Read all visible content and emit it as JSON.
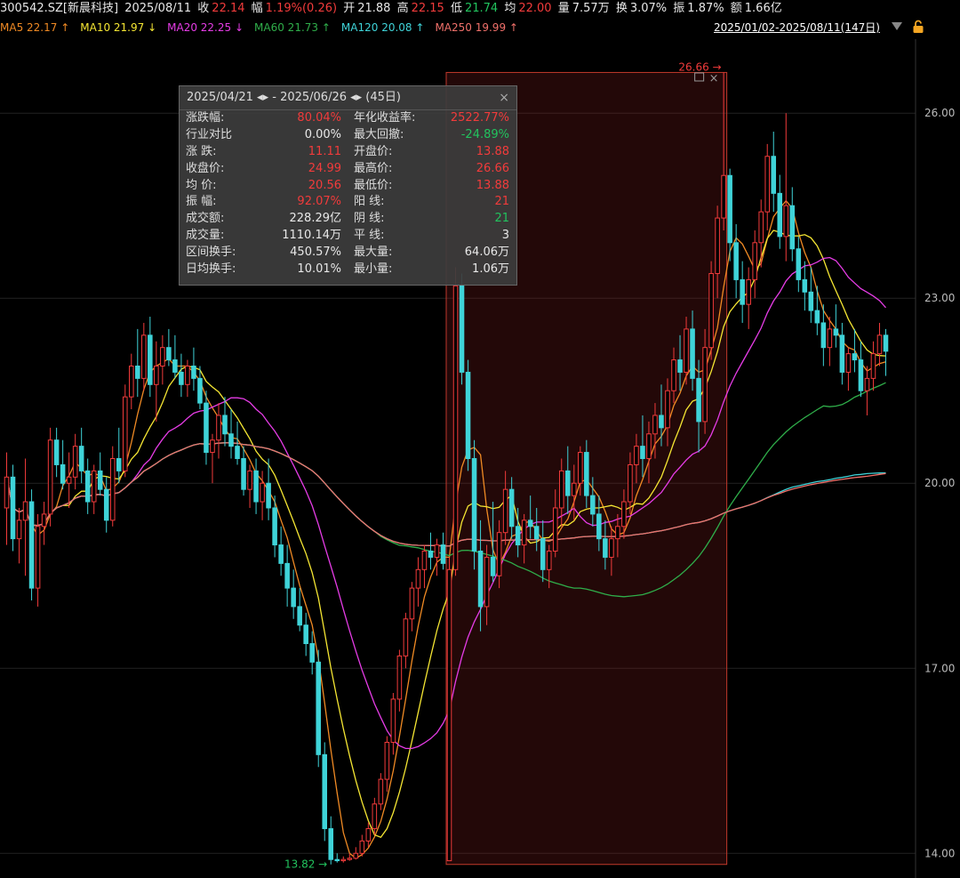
{
  "header": {
    "code": "300542.SZ[新晨科技]",
    "date": "2025/08/11",
    "close_label": "收",
    "close": "22.14",
    "change_label": "幅",
    "change": "1.19%(0.26)",
    "open_label": "开",
    "open": "21.88",
    "high_label": "高",
    "high": "22.15",
    "low_label": "低",
    "low": "21.74",
    "avg_label": "均",
    "avg": "22.00",
    "vol_label": "量",
    "vol": "7.57万",
    "turnover_label": "换",
    "turnover": "3.07%",
    "amp_label": "振",
    "amp": "1.87%",
    "amount_label": "额",
    "amount": "1.66亿"
  },
  "ma_legend": [
    {
      "label": "MA5 22.17",
      "arrow": "↑",
      "color": "#f08a24"
    },
    {
      "label": "MA10 21.97",
      "arrow": "↓",
      "color": "#f5e633"
    },
    {
      "label": "MA20 22.25",
      "arrow": "↓",
      "color": "#e63ce6"
    },
    {
      "label": "MA60 21.73",
      "arrow": "↑",
      "color": "#2fae4a"
    },
    {
      "label": "MA120 20.08",
      "arrow": "↑",
      "color": "#3fd3d8"
    },
    {
      "label": "MA250 19.99",
      "arrow": "↑",
      "color": "#f0706a"
    }
  ],
  "range_label": "2025/01/02-2025/08/11(147日)",
  "stats_panel": {
    "title": "2025/04/21 ◂▸ - 2025/06/26 ◂▸ (45日)",
    "close_icon": "×",
    "rows": [
      [
        {
          "k": "涨跌幅:",
          "v": "80.04%",
          "c": "red"
        },
        {
          "k": "年化收益率:",
          "v": "2522.77%",
          "c": "red"
        }
      ],
      [
        {
          "k": "行业对比",
          "v": "0.00%",
          "c": "white"
        },
        {
          "k": "最大回撤:",
          "v": "-24.89%",
          "c": "green"
        }
      ],
      [
        {
          "k": "涨 跌:",
          "v": "11.11",
          "c": "red"
        },
        {
          "k": "开盘价:",
          "v": "13.88",
          "c": "red"
        }
      ],
      [
        {
          "k": "收盘价:",
          "v": "24.99",
          "c": "red"
        },
        {
          "k": "最高价:",
          "v": "26.66",
          "c": "red"
        }
      ],
      [
        {
          "k": "均 价:",
          "v": "20.56",
          "c": "red"
        },
        {
          "k": "最低价:",
          "v": "13.88",
          "c": "red"
        }
      ],
      [
        {
          "k": "振 幅:",
          "v": "92.07%",
          "c": "red"
        },
        {
          "k": "阳 线:",
          "v": "21",
          "c": "red"
        }
      ],
      [
        {
          "k": "成交额:",
          "v": "228.29亿",
          "c": "white"
        },
        {
          "k": "阴 线:",
          "v": "21",
          "c": "green"
        }
      ],
      [
        {
          "k": "成交量:",
          "v": "1110.14万",
          "c": "white"
        },
        {
          "k": "平 线:",
          "v": "3",
          "c": "white"
        }
      ],
      [
        {
          "k": "区间换手:",
          "v": "450.57%",
          "c": "white"
        },
        {
          "k": "最大量:",
          "v": "64.06万",
          "c": "white"
        }
      ],
      [
        {
          "k": "日均换手:",
          "v": "10.01%",
          "c": "white"
        },
        {
          "k": "最小量:",
          "v": "1.06万",
          "c": "white"
        }
      ]
    ]
  },
  "chart_data": {
    "type": "candlestick",
    "y_ticks": [
      "26.00",
      "23.00",
      "20.00",
      "17.00",
      "14.00"
    ],
    "y_tick_values": [
      26,
      23,
      20,
      17,
      14
    ],
    "ylim": [
      13.6,
      27.2
    ],
    "selection_high_label": "26.66",
    "selection_low_label": "13.82",
    "selection_high": 26.66,
    "selection_low": 13.82,
    "selection_start_index": 71,
    "selection_end_index": 115,
    "up_color": "#f23b3b",
    "down_color": "#3fd3d8",
    "candles": [
      [
        19.6,
        20.5,
        19.0,
        20.1
      ],
      [
        20.1,
        20.3,
        18.9,
        19.1
      ],
      [
        19.1,
        19.6,
        18.7,
        19.4
      ],
      [
        19.4,
        20.4,
        18.5,
        19.7
      ],
      [
        19.7,
        19.9,
        18.1,
        18.3
      ],
      [
        18.3,
        19.5,
        18.0,
        19.3
      ],
      [
        19.3,
        19.7,
        19.0,
        19.5
      ],
      [
        19.5,
        20.9,
        19.3,
        20.7
      ],
      [
        20.7,
        20.9,
        20.1,
        20.3
      ],
      [
        20.3,
        20.7,
        19.9,
        20.0
      ],
      [
        20.0,
        20.5,
        19.6,
        20.1
      ],
      [
        20.1,
        20.8,
        19.9,
        20.6
      ],
      [
        20.6,
        20.9,
        20.0,
        20.2
      ],
      [
        20.2,
        20.4,
        19.5,
        19.7
      ],
      [
        19.7,
        20.3,
        19.5,
        20.2
      ],
      [
        20.2,
        20.5,
        19.8,
        19.9
      ],
      [
        19.9,
        20.1,
        19.2,
        19.4
      ],
      [
        19.4,
        20.6,
        19.3,
        20.4
      ],
      [
        20.4,
        20.9,
        20.0,
        20.2
      ],
      [
        20.2,
        21.6,
        20.1,
        21.4
      ],
      [
        21.4,
        22.1,
        21.2,
        21.9
      ],
      [
        21.9,
        22.5,
        21.4,
        21.7
      ],
      [
        21.7,
        22.6,
        21.5,
        22.4
      ],
      [
        22.4,
        22.7,
        21.4,
        21.6
      ],
      [
        21.6,
        22.3,
        21.0,
        21.9
      ],
      [
        21.9,
        22.4,
        21.6,
        22.2
      ],
      [
        22.2,
        22.5,
        21.9,
        22.0
      ],
      [
        22.0,
        22.4,
        21.7,
        21.8
      ],
      [
        21.8,
        22.1,
        21.4,
        21.6
      ],
      [
        21.6,
        22.0,
        21.4,
        21.9
      ],
      [
        21.9,
        22.2,
        21.5,
        21.7
      ],
      [
        21.7,
        21.9,
        21.2,
        21.3
      ],
      [
        21.3,
        21.5,
        20.3,
        20.5
      ],
      [
        20.5,
        20.8,
        20.0,
        20.7
      ],
      [
        20.7,
        21.3,
        20.4,
        21.1
      ],
      [
        21.1,
        21.4,
        20.6,
        20.8
      ],
      [
        20.8,
        21.2,
        20.4,
        20.6
      ],
      [
        20.6,
        21.0,
        20.3,
        20.4
      ],
      [
        20.4,
        20.6,
        19.8,
        19.9
      ],
      [
        19.9,
        20.3,
        19.6,
        20.2
      ],
      [
        20.2,
        20.4,
        19.5,
        19.7
      ],
      [
        19.7,
        20.2,
        19.4,
        20.0
      ],
      [
        20.0,
        20.4,
        19.4,
        19.6
      ],
      [
        19.6,
        19.8,
        18.8,
        19.0
      ],
      [
        19.0,
        19.3,
        18.5,
        18.7
      ],
      [
        18.7,
        19.0,
        18.0,
        18.3
      ],
      [
        18.3,
        18.6,
        17.8,
        18.0
      ],
      [
        18.0,
        18.3,
        17.6,
        17.7
      ],
      [
        17.7,
        17.9,
        17.2,
        17.4
      ],
      [
        17.4,
        17.6,
        16.9,
        17.1
      ],
      [
        17.1,
        17.3,
        15.4,
        15.6
      ],
      [
        15.6,
        15.8,
        14.2,
        14.4
      ],
      [
        14.4,
        14.6,
        13.82,
        13.9
      ],
      [
        13.9,
        14.0,
        13.85,
        13.88
      ],
      [
        13.88,
        13.95,
        13.85,
        13.9
      ],
      [
        13.9,
        14.0,
        13.88,
        13.92
      ],
      [
        13.92,
        14.1,
        13.9,
        14.0
      ],
      [
        14.0,
        14.3,
        13.95,
        14.2
      ],
      [
        14.2,
        14.5,
        14.1,
        14.4
      ],
      [
        14.4,
        14.9,
        14.3,
        14.8
      ],
      [
        14.8,
        15.3,
        14.7,
        15.2
      ],
      [
        15.2,
        15.9,
        15.0,
        15.8
      ],
      [
        15.8,
        16.6,
        15.6,
        16.5
      ],
      [
        16.5,
        17.3,
        16.3,
        17.2
      ],
      [
        17.2,
        17.9,
        17.0,
        17.8
      ],
      [
        17.8,
        18.4,
        17.6,
        18.3
      ],
      [
        18.3,
        18.8,
        18.0,
        18.6
      ],
      [
        18.6,
        19.0,
        18.3,
        18.9
      ],
      [
        18.9,
        19.2,
        18.6,
        18.8
      ],
      [
        18.8,
        19.1,
        18.5,
        19.0
      ],
      [
        19.0,
        19.2,
        18.6,
        18.7
      ],
      [
        13.88,
        18.8,
        13.88,
        18.6
      ],
      [
        18.6,
        23.5,
        18.5,
        23.2
      ],
      [
        23.2,
        23.4,
        21.6,
        21.8
      ],
      [
        21.8,
        22.0,
        20.2,
        20.4
      ],
      [
        20.4,
        20.7,
        18.6,
        18.9
      ],
      [
        18.9,
        19.4,
        17.6,
        18.0
      ],
      [
        18.0,
        19.0,
        17.7,
        18.8
      ],
      [
        18.8,
        19.7,
        18.4,
        18.5
      ],
      [
        18.5,
        19.4,
        18.3,
        19.2
      ],
      [
        19.2,
        20.2,
        19.0,
        19.9
      ],
      [
        19.9,
        20.1,
        19.1,
        19.3
      ],
      [
        19.3,
        19.6,
        18.8,
        19.0
      ],
      [
        19.0,
        19.5,
        18.7,
        19.4
      ],
      [
        19.4,
        19.8,
        19.1,
        19.3
      ],
      [
        19.3,
        19.6,
        18.9,
        19.1
      ],
      [
        19.1,
        19.4,
        18.4,
        18.6
      ],
      [
        18.6,
        19.0,
        18.3,
        18.9
      ],
      [
        18.9,
        19.9,
        18.8,
        19.6
      ],
      [
        19.6,
        20.4,
        19.3,
        20.2
      ],
      [
        20.2,
        20.6,
        19.5,
        19.8
      ],
      [
        19.8,
        20.3,
        19.4,
        20.0
      ],
      [
        20.0,
        20.6,
        19.8,
        20.5
      ],
      [
        20.5,
        20.7,
        19.6,
        19.8
      ],
      [
        19.8,
        20.1,
        19.3,
        19.5
      ],
      [
        19.5,
        19.8,
        18.9,
        19.1
      ],
      [
        19.1,
        19.4,
        18.6,
        18.8
      ],
      [
        18.8,
        19.3,
        18.5,
        19.1
      ],
      [
        19.1,
        19.5,
        18.8,
        19.3
      ],
      [
        19.3,
        19.9,
        19.1,
        19.7
      ],
      [
        19.7,
        20.5,
        19.5,
        20.3
      ],
      [
        20.3,
        20.8,
        20.0,
        20.6
      ],
      [
        20.6,
        21.1,
        20.1,
        20.4
      ],
      [
        20.4,
        21.0,
        20.0,
        20.8
      ],
      [
        20.8,
        21.3,
        20.4,
        21.1
      ],
      [
        21.1,
        21.6,
        20.6,
        20.9
      ],
      [
        20.9,
        21.7,
        20.6,
        21.5
      ],
      [
        21.5,
        22.2,
        21.3,
        22.0
      ],
      [
        22.0,
        22.4,
        21.5,
        21.8
      ],
      [
        21.8,
        22.7,
        21.6,
        22.5
      ],
      [
        22.5,
        22.8,
        21.5,
        21.7
      ],
      [
        21.7,
        22.0,
        20.5,
        21.0
      ],
      [
        21.0,
        22.5,
        20.8,
        22.2
      ],
      [
        22.2,
        23.6,
        22.0,
        23.4
      ],
      [
        23.4,
        24.5,
        23.0,
        24.3
      ],
      [
        24.3,
        26.66,
        24.1,
        24.99
      ],
      [
        24.99,
        25.1,
        23.6,
        23.9
      ],
      [
        23.9,
        24.2,
        23.0,
        23.3
      ],
      [
        23.3,
        23.6,
        22.6,
        22.9
      ],
      [
        22.9,
        23.5,
        22.5,
        23.3
      ],
      [
        23.3,
        24.1,
        23.0,
        23.9
      ],
      [
        23.9,
        24.6,
        23.5,
        24.4
      ],
      [
        24.4,
        25.5,
        24.1,
        25.3
      ],
      [
        25.3,
        25.7,
        24.4,
        24.7
      ],
      [
        24.7,
        25.0,
        23.8,
        24.0
      ],
      [
        24.0,
        26.0,
        23.6,
        24.5
      ],
      [
        24.5,
        24.8,
        23.6,
        23.8
      ],
      [
        23.8,
        24.0,
        23.1,
        23.3
      ],
      [
        23.3,
        23.6,
        22.8,
        23.1
      ],
      [
        23.1,
        23.5,
        22.6,
        22.8
      ],
      [
        22.8,
        23.2,
        22.4,
        22.6
      ],
      [
        22.6,
        22.9,
        21.9,
        22.2
      ],
      [
        22.2,
        22.7,
        21.9,
        22.5
      ],
      [
        22.5,
        22.9,
        22.2,
        22.4
      ],
      [
        22.4,
        22.6,
        21.6,
        21.8
      ],
      [
        21.8,
        22.2,
        21.5,
        22.1
      ],
      [
        22.1,
        22.5,
        21.8,
        22.0
      ],
      [
        22.0,
        22.3,
        21.4,
        21.5
      ],
      [
        21.5,
        21.9,
        21.1,
        21.7
      ],
      [
        21.7,
        22.3,
        21.5,
        22.1
      ],
      [
        22.1,
        22.6,
        21.9,
        22.4
      ],
      [
        22.4,
        22.5,
        21.74,
        22.14
      ]
    ]
  }
}
